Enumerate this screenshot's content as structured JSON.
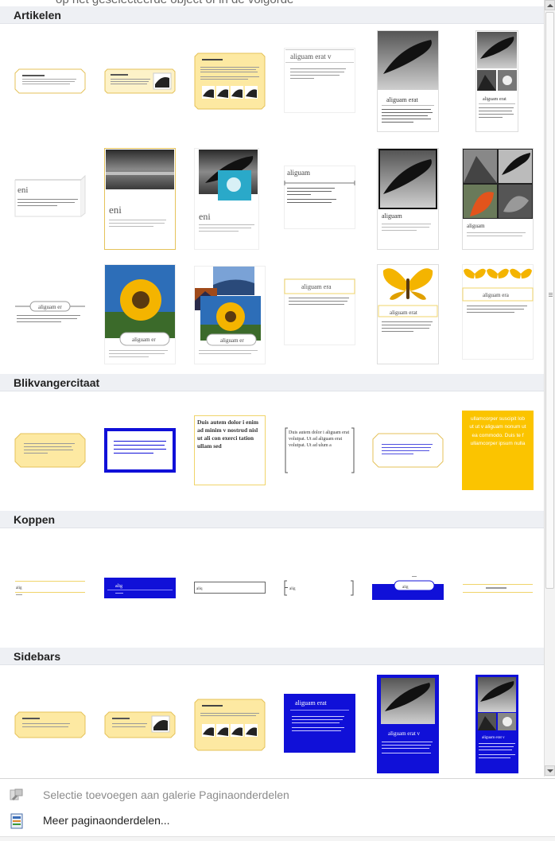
{
  "top_cut_text": "op het geselecteerde object of in de volgorde",
  "sections": [
    {
      "id": "artikelen",
      "title": "Artikelen"
    },
    {
      "id": "blikvanger",
      "title": "Blikvangercitaat"
    },
    {
      "id": "koppen",
      "title": "Koppen"
    },
    {
      "id": "sidebars",
      "title": "Sidebars"
    }
  ],
  "thumb_text": {
    "aliquam_erat_v": "aliguam erat v",
    "aliquam_erat": "aliguam erat",
    "aliquam": "aliguam",
    "aliquam_era": "aliguam era",
    "aliquam_er": "aliguam er",
    "eni": "eni",
    "alig": "alig",
    "aliq": "aliq",
    "quote": "Duis autem dolor i enim ad minim v nostrud nisl ut ali con exerci tation ullam sed",
    "quote2": "Duis autem dolor i aliguam erat volutpat. Ut ad aliguam erat volutpat. Ut ad ulum a",
    "yellow_quote": "ullamcorper suscipit lob ut ut v aliguam nonum ut ea commodo. Duis te f ullamcorper ipsum nulla"
  },
  "menu": [
    {
      "label": "Selectie toevoegen aan galerie Paginaonderdelen",
      "enabled": false
    },
    {
      "label": "Meer paginaonderdelen...",
      "enabled": true
    }
  ],
  "colors": {
    "yellow": "#fdeab0",
    "blue": "#1010d8",
    "gold": "#fbc400"
  }
}
